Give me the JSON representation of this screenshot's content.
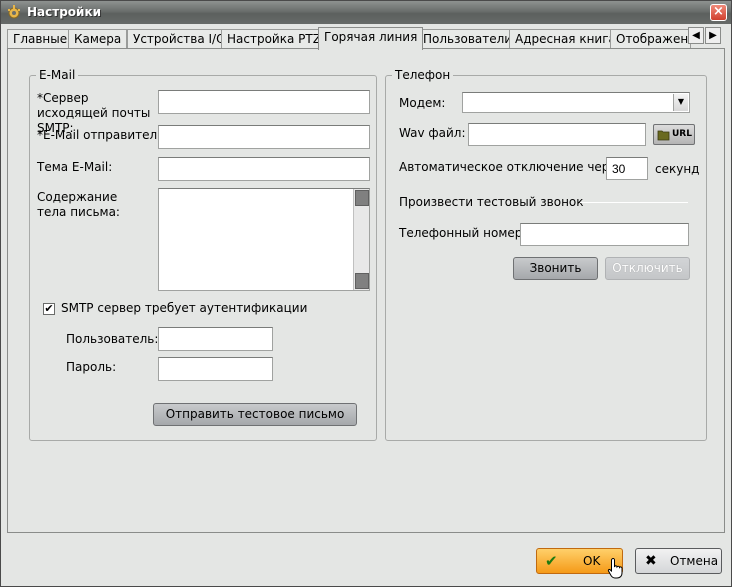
{
  "window": {
    "title": "Настройки",
    "close_glyph": "×"
  },
  "tabs": [
    {
      "label": "Главные"
    },
    {
      "label": "Камера"
    },
    {
      "label": "Устройства I/O"
    },
    {
      "label": "Настройка PTZ"
    },
    {
      "label": "Горячая линия"
    },
    {
      "label": "Пользователи"
    },
    {
      "label": "Адресная книга"
    },
    {
      "label": "Отображен"
    }
  ],
  "tab_scroll": {
    "left": "◀",
    "right": "▶"
  },
  "email": {
    "legend": "E-Mail",
    "smtp_label": "*Сервер исходящей почты SMTP:",
    "smtp_value": "",
    "sender_label": "*E-Mail отправитель:",
    "sender_value": "",
    "subject_label": "Тема E-Mail:",
    "subject_value": "",
    "body_label": "Содержание тела письма:",
    "body_value": "",
    "auth_checked": "✔",
    "auth_label": "SMTP сервер требует аутентификации",
    "user_label": "Пользователь:",
    "user_value": "",
    "password_label": "Пароль:",
    "password_value": "",
    "test_button": "Отправить тестовое письмо"
  },
  "phone": {
    "legend": "Телефон",
    "modem_label": "Модем:",
    "modem_value": "",
    "modem_arrow": "▼",
    "wav_label": "Wav файл:",
    "wav_value": "",
    "url_button": "URL",
    "auto_off_label": "Автоматическое отключение через",
    "auto_off_value": "30",
    "auto_off_unit": "секунд",
    "test_call_header": "Произвести тестовый звонок",
    "phone_number_label": "Телефонный номер:",
    "phone_number_value": "",
    "call_button": "Звонить",
    "disconnect_button": "Отключить"
  },
  "footer": {
    "ok_label": "OK",
    "ok_icon": "✔",
    "cancel_label": "Отмена",
    "cancel_icon": "✖"
  },
  "colors": {
    "ok_accent": "#f59a18",
    "title_bar": "#6a6e6c",
    "window_bg": "#e4e6e4"
  }
}
